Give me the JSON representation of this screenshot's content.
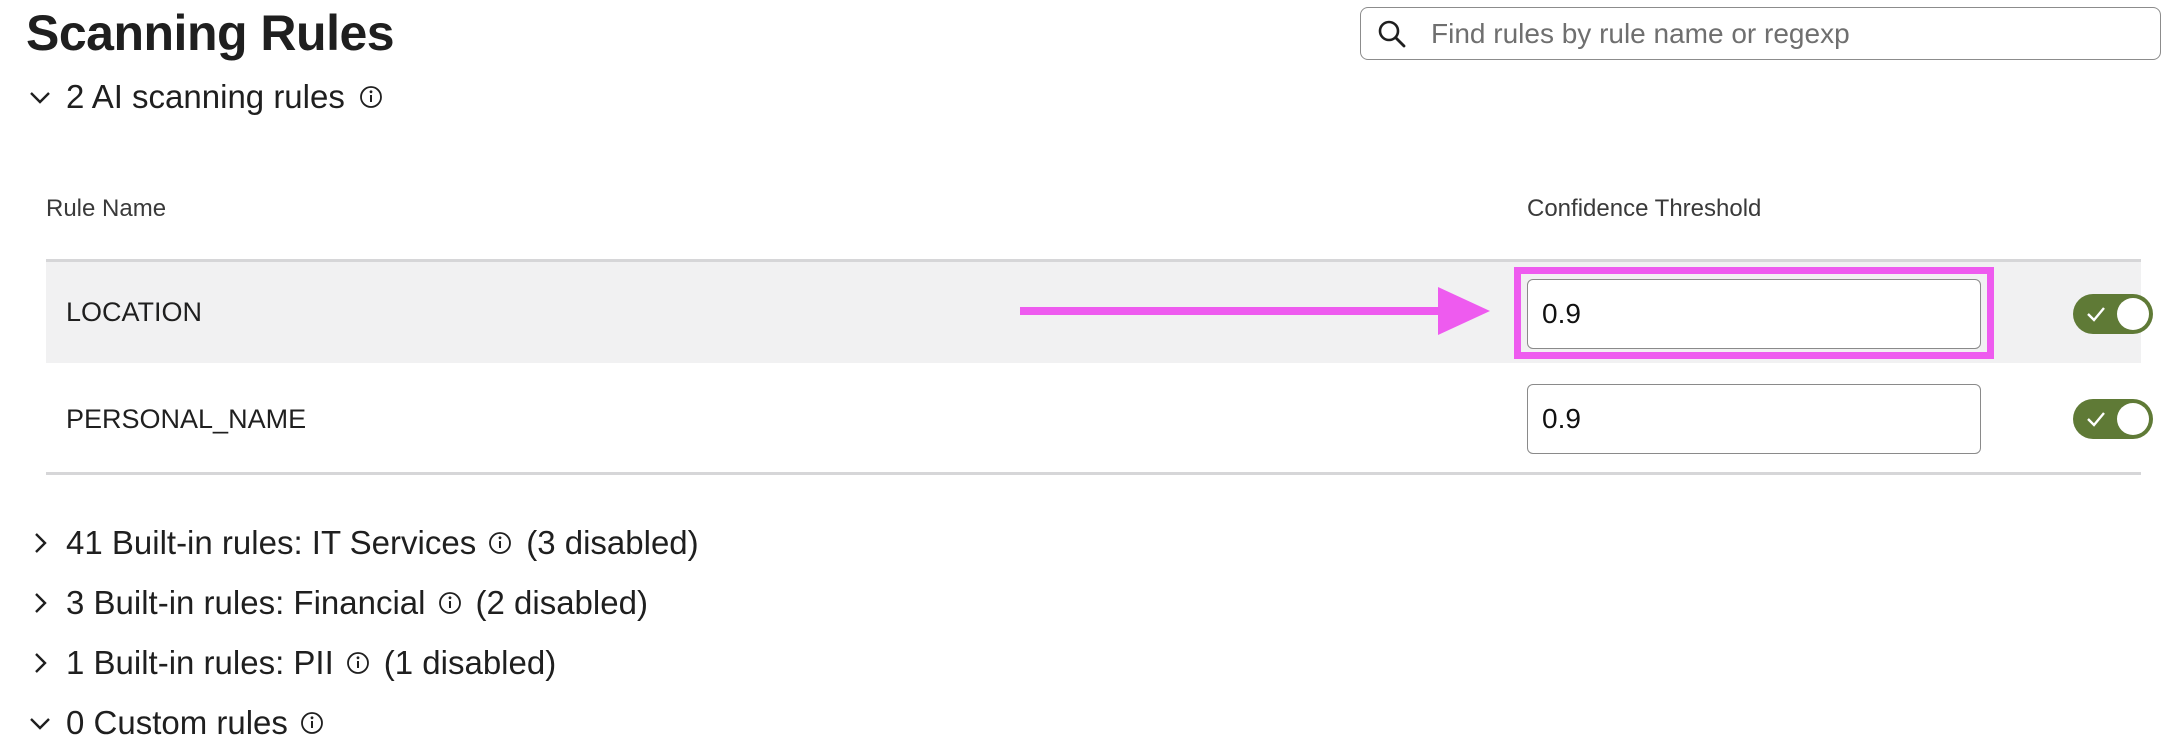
{
  "page": {
    "title": "Scanning Rules"
  },
  "search": {
    "placeholder": "Find rules by rule name or regexp",
    "value": ""
  },
  "ai_section": {
    "label": "2 AI scanning rules",
    "expanded": true,
    "columns": {
      "rule_name": "Rule Name",
      "confidence": "Confidence Threshold"
    },
    "rules": [
      {
        "name": "LOCATION",
        "threshold": "0.9",
        "enabled": true,
        "highlighted": true
      },
      {
        "name": "PERSONAL_NAME",
        "threshold": "0.9",
        "enabled": true,
        "highlighted": false
      }
    ]
  },
  "builtin_sections": [
    {
      "label": "41 Built-in rules: IT Services",
      "suffix": "(3 disabled)",
      "expanded": false
    },
    {
      "label": "3 Built-in rules: Financial",
      "suffix": "(2 disabled)",
      "expanded": false
    },
    {
      "label": "1 Built-in rules: PII",
      "suffix": "(1 disabled)",
      "expanded": false
    }
  ],
  "custom_section": {
    "label": "0 Custom rules",
    "expanded": true
  },
  "colors": {
    "toggle_on": "#5f7a36",
    "highlight": "#ee5bef",
    "row_selected_bg": "#f1f1f2"
  },
  "icons": {
    "search": "search-icon",
    "info": "info-icon",
    "chevron_down": "chevron-down-icon",
    "chevron_right": "chevron-right-icon",
    "check": "check-icon",
    "arrow": "arrow-annotation"
  }
}
